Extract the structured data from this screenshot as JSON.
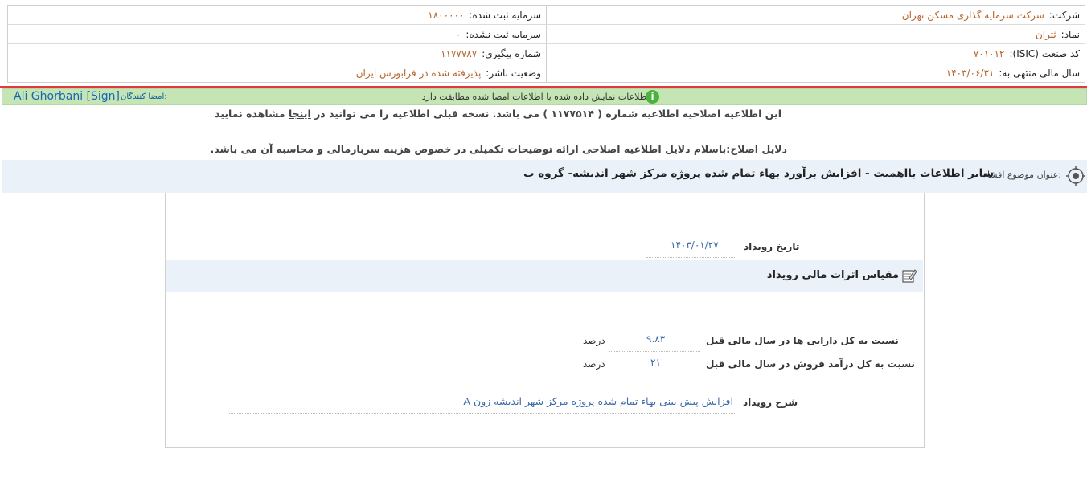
{
  "header": {
    "company_label": "شرکت:",
    "company_value": "شرکت سرمایه گذاری مسکن تهران",
    "registered_capital_label": "سرمایه ثبت شده:",
    "registered_capital_value": "۱۸۰۰۰۰۰",
    "symbol_label": "نماد:",
    "symbol_value": "ثتران",
    "unregistered_capital_label": "سرمایه ثبت نشده:",
    "unregistered_capital_value": "۰",
    "isic_label": "کد صنعت (ISIC):",
    "isic_value": "۷۰۱۰۱۲",
    "tracking_label": "شماره پیگیری:",
    "tracking_value": "۱۱۷۷۷۸۷",
    "fiscal_year_label": "سال مالی منتهی به:",
    "fiscal_year_value": "۱۴۰۳/۰۶/۳۱",
    "publisher_status_label": "وضعیت ناشر:",
    "publisher_status_value": "پذیرفته شده در فرابورس ایران"
  },
  "sign": {
    "signers_label": "امضا کنندگان:",
    "signer_name": "Ali Ghorbani [Sign]",
    "verify_message": "اطلاعات نمایش داده شده با اطلاعات امضا شده مطابقت دارد.",
    "info_icon": "i"
  },
  "notice": {
    "text_before": "این اطلاعیه اصلاحیه اطلاعیه شماره ( ۱۱۷۷۵۱۴ ) می باشد. نسخه قبلی اطلاعیه را می توانید در ",
    "link": "اینجا",
    "text_after": " مشاهده نمایید",
    "reason": "دلایل اصلاح:باسلام دلایل اطلاعیه اصلاحی ارائه توضیحات تکمیلی در خصوص هزینه سربارمالی و محاسبه آن می باشد."
  },
  "title": {
    "label": "عنوان موضوع افشاء:",
    "text": "سایر اطلاعات بااهمیت - افزایش برآورد بهاء تمام شده پروژه مرکز شهر اندیشه- گروه ب"
  },
  "event": {
    "date_label": "تاریخ رویداد",
    "date_value": "۱۴۰۳/۰۱/۲۷"
  },
  "section": {
    "title": "مقیاس اثرات مالی رویداد"
  },
  "metrics": [
    {
      "label": "نسبت به کل دارایی ها در سال مالی قبل",
      "value": "۹.۸۳",
      "unit": "درصد"
    },
    {
      "label": "نسبت به کل درآمد فروش در سال مالی قبل",
      "value": "۲۱",
      "unit": "درصد"
    }
  ],
  "description": {
    "label": "شرح رویداد",
    "value": "افزایش پیش بینی بهاء تمام شده پروژه مرکز شهر اندیشه زون A"
  },
  "colors": {
    "value_orange": "#b5632a",
    "value_blue": "#3b6aa8",
    "sign_green": "#c5e5b4",
    "title_bg": "#eaf1f8",
    "red_line": "#e0393e"
  }
}
